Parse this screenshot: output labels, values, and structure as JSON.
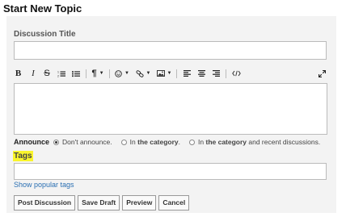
{
  "page": {
    "title": "Start New Topic"
  },
  "form": {
    "discussion_title_label": "Discussion Title",
    "discussion_title_value": "",
    "editor_value": ""
  },
  "toolbar": {
    "bold": "B",
    "italic": "I",
    "strike": "S",
    "paragraph": "¶"
  },
  "announce": {
    "label": "Announce",
    "options": [
      {
        "text": "Don't announce.",
        "selected": true
      },
      {
        "pre": "In ",
        "bold": "the category",
        "post": ".",
        "selected": false
      },
      {
        "pre": "In ",
        "bold": "the category",
        "post": " and recent discussions.",
        "selected": false
      }
    ]
  },
  "tags": {
    "label": "Tags",
    "value": "",
    "popular_link": "Show popular tags"
  },
  "buttons": {
    "post": "Post Discussion",
    "save_draft": "Save Draft",
    "preview": "Preview",
    "cancel": "Cancel"
  },
  "colors": {
    "panel_bg": "#f3f3f3",
    "link": "#2a6fb2",
    "highlight": "#faf52c"
  }
}
